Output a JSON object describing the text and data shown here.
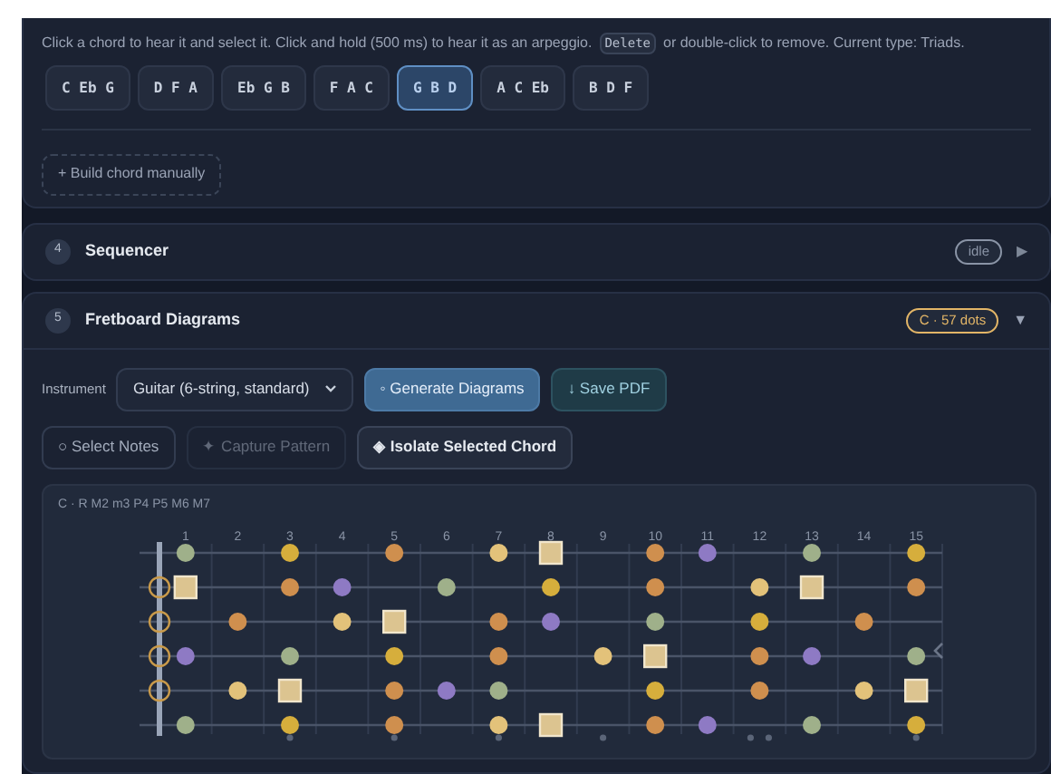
{
  "chords_section": {
    "hint_before": "Click a chord to hear it and select it. Click and hold (500 ms) to hear it as an arpeggio.",
    "hint_key": "Delete",
    "hint_after": "or double-click to remove. Current type: Triads.",
    "chords": [
      {
        "label": "C Eb G",
        "selected": false
      },
      {
        "label": "D F A",
        "selected": false
      },
      {
        "label": "Eb G B",
        "selected": false
      },
      {
        "label": "F A C",
        "selected": false
      },
      {
        "label": "G B D",
        "selected": true
      },
      {
        "label": "A C Eb",
        "selected": false
      },
      {
        "label": "B D F",
        "selected": false
      }
    ],
    "build_button": "+ Build chord manually"
  },
  "sections": [
    {
      "number": "4",
      "title": "Sequencer",
      "badge": {
        "text": "idle",
        "color": "#8a94a6"
      },
      "toggle": "▶",
      "expanded": false
    },
    {
      "number": "5",
      "title": "Fretboard Diagrams",
      "badge": {
        "text": "C · 57 dots",
        "color": "#e2b567"
      },
      "toggle": "▼",
      "expanded": true
    }
  ],
  "fretboard": {
    "instrument_label": "Instrument",
    "instrument_value": "Guitar (6-string, standard)",
    "actions": [
      {
        "label": "◦ Generate Diagrams",
        "kind": "primary",
        "disabled": false
      },
      {
        "label": "↓ Save PDF",
        "kind": "accent",
        "disabled": false
      }
    ],
    "tools": [
      {
        "label": "○ Select Notes",
        "kind": "outline",
        "disabled": false
      },
      {
        "label": "✦ Capture Pattern",
        "kind": "outline",
        "disabled": true
      },
      {
        "label": "◈ Isolate Selected Chord",
        "kind": "solid",
        "disabled": false
      }
    ],
    "caption": "C · R M2 m3 P4 P5 M6 M7",
    "frets": [
      {
        "label": "1",
        "kind": "plain"
      },
      {
        "label": "2",
        "kind": "plain"
      },
      {
        "label": "3",
        "kind": "inlay"
      },
      {
        "label": "4",
        "kind": "plain"
      },
      {
        "label": "5",
        "kind": "inlay"
      },
      {
        "label": "6",
        "kind": "plain"
      },
      {
        "label": "7",
        "kind": "inlay"
      },
      {
        "label": "8",
        "kind": "plain"
      },
      {
        "label": "9",
        "kind": "inlay"
      },
      {
        "label": "10",
        "kind": "plain"
      },
      {
        "label": "11",
        "kind": "plain"
      },
      {
        "label": "12",
        "kind": "double_inlay"
      },
      {
        "label": "13",
        "kind": "plain"
      },
      {
        "label": "14",
        "kind": "plain"
      },
      {
        "label": "15",
        "kind": "inlay"
      }
    ],
    "strings": [
      {
        "cells": [
          {
            "kind": "empty"
          },
          {
            "kind": "dot",
            "color": "#9fb08a"
          },
          {
            "kind": "empty"
          },
          {
            "kind": "dot",
            "color": "#d6ae3c"
          },
          {
            "kind": "empty"
          },
          {
            "kind": "dot",
            "color": "#cf8f4e"
          },
          {
            "kind": "empty"
          },
          {
            "kind": "dot",
            "color": "#e3c27a"
          },
          {
            "kind": "root",
            "color": "#dcc490"
          },
          {
            "kind": "empty"
          },
          {
            "kind": "dot",
            "color": "#cf8f4e"
          },
          {
            "kind": "dot",
            "color": "#8e7ac4"
          },
          {
            "kind": "empty"
          },
          {
            "kind": "dot",
            "color": "#9fb08a"
          },
          {
            "kind": "empty"
          },
          {
            "kind": "dot",
            "color": "#d6ae3c"
          }
        ]
      },
      {
        "cells": [
          {
            "kind": "open",
            "color": "#c99a4a"
          },
          {
            "kind": "root",
            "color": "#dcc490"
          },
          {
            "kind": "empty"
          },
          {
            "kind": "dot",
            "color": "#cf8f4e"
          },
          {
            "kind": "dot",
            "color": "#8e7ac4"
          },
          {
            "kind": "empty"
          },
          {
            "kind": "dot",
            "color": "#9fb08a"
          },
          {
            "kind": "empty"
          },
          {
            "kind": "dot",
            "color": "#d6ae3c"
          },
          {
            "kind": "empty"
          },
          {
            "kind": "dot",
            "color": "#cf8f4e"
          },
          {
            "kind": "empty"
          },
          {
            "kind": "dot",
            "color": "#e3c27a"
          },
          {
            "kind": "root",
            "color": "#dcc490"
          },
          {
            "kind": "empty"
          },
          {
            "kind": "dot",
            "color": "#cf8f4e"
          }
        ]
      },
      {
        "cells": [
          {
            "kind": "open",
            "color": "#c99a4a"
          },
          {
            "kind": "empty"
          },
          {
            "kind": "dot",
            "color": "#cf8f4e"
          },
          {
            "kind": "empty"
          },
          {
            "kind": "dot",
            "color": "#e3c27a"
          },
          {
            "kind": "root",
            "color": "#dcc490"
          },
          {
            "kind": "empty"
          },
          {
            "kind": "dot",
            "color": "#cf8f4e"
          },
          {
            "kind": "dot",
            "color": "#8e7ac4"
          },
          {
            "kind": "empty"
          },
          {
            "kind": "dot",
            "color": "#9fb08a"
          },
          {
            "kind": "empty"
          },
          {
            "kind": "dot",
            "color": "#d6ae3c"
          },
          {
            "kind": "empty"
          },
          {
            "kind": "dot",
            "color": "#cf8f4e"
          },
          {
            "kind": "empty"
          }
        ]
      },
      {
        "cells": [
          {
            "kind": "open",
            "color": "#c99a4a"
          },
          {
            "kind": "dot",
            "color": "#8e7ac4"
          },
          {
            "kind": "empty"
          },
          {
            "kind": "dot",
            "color": "#9fb08a"
          },
          {
            "kind": "empty"
          },
          {
            "kind": "dot",
            "color": "#d6ae3c"
          },
          {
            "kind": "empty"
          },
          {
            "kind": "dot",
            "color": "#cf8f4e"
          },
          {
            "kind": "empty"
          },
          {
            "kind": "dot",
            "color": "#e3c27a"
          },
          {
            "kind": "root",
            "color": "#dcc490"
          },
          {
            "kind": "empty"
          },
          {
            "kind": "dot",
            "color": "#cf8f4e"
          },
          {
            "kind": "dot",
            "color": "#8e7ac4"
          },
          {
            "kind": "empty"
          },
          {
            "kind": "dot",
            "color": "#9fb08a"
          }
        ]
      },
      {
        "cells": [
          {
            "kind": "open",
            "color": "#c99a4a"
          },
          {
            "kind": "empty"
          },
          {
            "kind": "dot",
            "color": "#e3c27a"
          },
          {
            "kind": "root",
            "color": "#dcc490"
          },
          {
            "kind": "empty"
          },
          {
            "kind": "dot",
            "color": "#cf8f4e"
          },
          {
            "kind": "dot",
            "color": "#8e7ac4"
          },
          {
            "kind": "dot",
            "color": "#9fb08a"
          },
          {
            "kind": "empty"
          },
          {
            "kind": "empty"
          },
          {
            "kind": "dot",
            "color": "#d6ae3c"
          },
          {
            "kind": "empty"
          },
          {
            "kind": "dot",
            "color": "#cf8f4e"
          },
          {
            "kind": "empty"
          },
          {
            "kind": "dot",
            "color": "#e3c27a"
          },
          {
            "kind": "root",
            "color": "#dcc490"
          }
        ]
      },
      {
        "cells": [
          {
            "kind": "empty"
          },
          {
            "kind": "dot",
            "color": "#9fb08a"
          },
          {
            "kind": "empty"
          },
          {
            "kind": "dot",
            "color": "#d6ae3c"
          },
          {
            "kind": "empty"
          },
          {
            "kind": "dot",
            "color": "#cf8f4e"
          },
          {
            "kind": "empty"
          },
          {
            "kind": "dot",
            "color": "#e3c27a"
          },
          {
            "kind": "root",
            "color": "#dcc490"
          },
          {
            "kind": "empty"
          },
          {
            "kind": "dot",
            "color": "#cf8f4e"
          },
          {
            "kind": "dot",
            "color": "#8e7ac4"
          },
          {
            "kind": "empty"
          },
          {
            "kind": "dot",
            "color": "#9fb08a"
          },
          {
            "kind": "empty"
          },
          {
            "kind": "dot",
            "color": "#d6ae3c"
          }
        ]
      }
    ]
  }
}
